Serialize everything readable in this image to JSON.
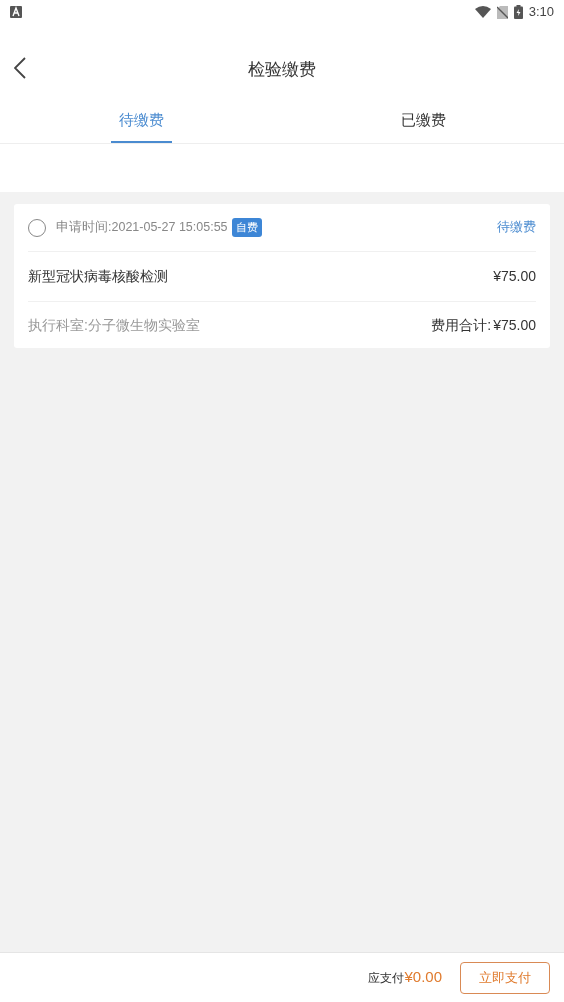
{
  "status_bar": {
    "time": "3:10"
  },
  "header": {
    "title": "检验缴费"
  },
  "tabs": [
    {
      "label": "待缴费",
      "selected": true
    },
    {
      "label": "已缴费",
      "selected": false
    }
  ],
  "orders": [
    {
      "checked": false,
      "request_time": "申请时间:2021-05-27 15:05:55",
      "badge": "自费",
      "status": "待缴费",
      "item": "新型冠状病毒核酸检测",
      "price": "¥75.00",
      "department": "执行科室:分子微生物实验室",
      "total_label": "费用合计:",
      "total": "¥75.00"
    }
  ],
  "footer": {
    "label": "应支付",
    "amount": "¥0.00",
    "pay_button": "立即支付"
  }
}
